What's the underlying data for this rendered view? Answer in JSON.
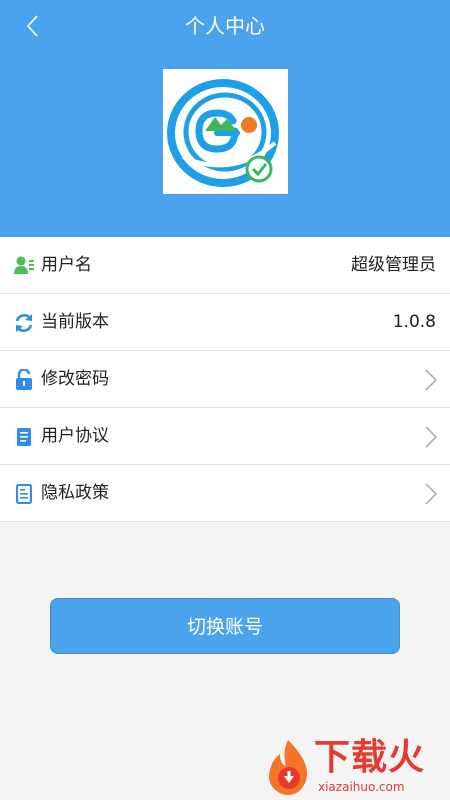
{
  "header": {
    "title": "个人中心",
    "back_icon": "chevron-left-icon",
    "bg_color": "#4aa3ec"
  },
  "avatar": {
    "icon": "app-logo"
  },
  "menu": {
    "items": [
      {
        "label": "用户名",
        "icon": "user-icon",
        "value": "超级管理员"
      },
      {
        "label": "当前版本",
        "icon": "refresh-icon",
        "value": "1.0.8"
      },
      {
        "label": "修改密码",
        "icon": "lock-icon"
      },
      {
        "label": "用户协议",
        "icon": "document-icon"
      },
      {
        "label": "隐私政策",
        "icon": "policy-document-icon"
      }
    ]
  },
  "switch_account": {
    "label": "切换账号"
  },
  "watermark": {
    "brand": "下载火",
    "url": "xiazaihuo.com"
  },
  "colors": {
    "accent": "#4aa3ec",
    "icon_blue": "#2f8de8",
    "icon_green": "#4cbf5a"
  }
}
